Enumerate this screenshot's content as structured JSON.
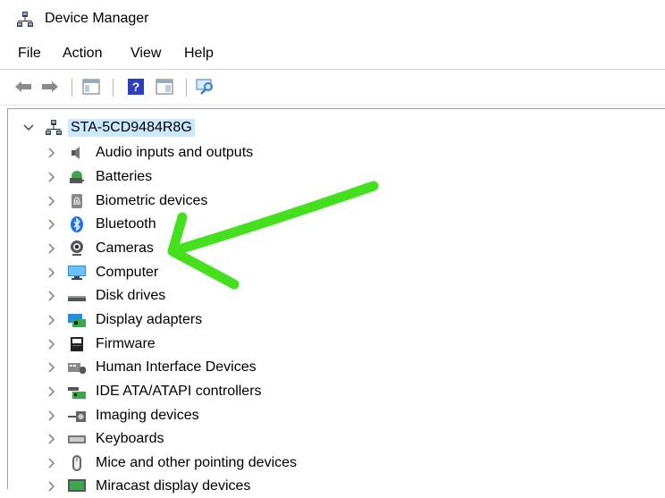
{
  "window": {
    "title": "Device Manager"
  },
  "menu": [
    "File",
    "Action",
    "View",
    "Help"
  ],
  "tree": {
    "root": "STA-5CD9484R8G",
    "categories": [
      "Audio inputs and outputs",
      "Batteries",
      "Biometric devices",
      "Bluetooth",
      "Cameras",
      "Computer",
      "Disk drives",
      "Display adapters",
      "Firmware",
      "Human Interface Devices",
      "IDE ATA/ATAPI controllers",
      "Imaging devices",
      "Keyboards",
      "Mice and other pointing devices",
      "Miracast display devices"
    ]
  },
  "colors": {
    "annotation_arrow": "#44e01e",
    "root_highlight": "#cce8ff"
  }
}
